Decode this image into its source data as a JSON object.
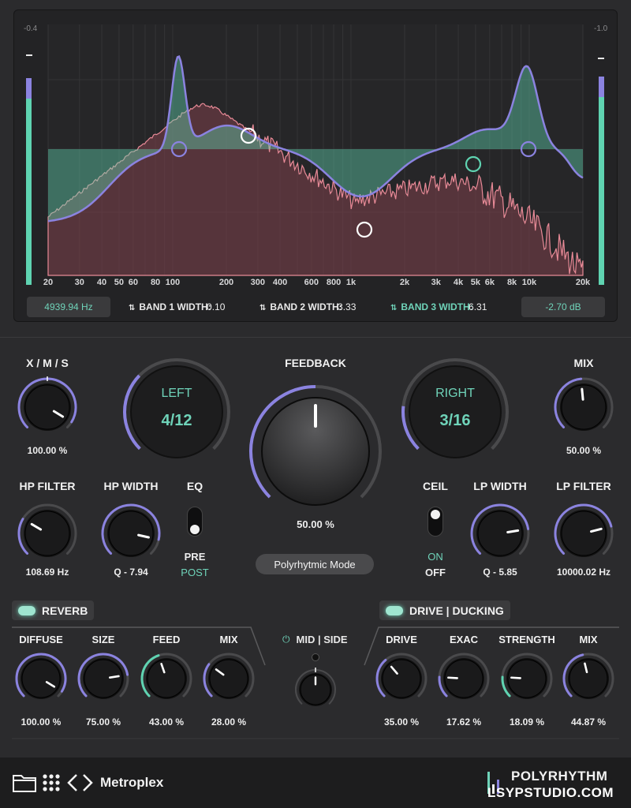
{
  "eq": {
    "corner_left": "-0.4",
    "corner_right": "-1.0",
    "freq_labels": [
      "20",
      "30",
      "40",
      "50",
      "60",
      "80",
      "100",
      "200",
      "300",
      "400",
      "600",
      "800",
      "1k",
      "2k",
      "3k",
      "4k",
      "5k",
      "6k",
      "8k",
      "10k",
      "20k"
    ],
    "readout_freq": "4939.94 Hz",
    "readout_db": "-2.70 dB",
    "bands": [
      {
        "label": "BAND 1 WIDTH:",
        "value": "0.10"
      },
      {
        "label": "BAND 2 WIDTH:",
        "value": "3.33"
      },
      {
        "label": "BAND 3 WIDTH:",
        "value": "6.31"
      }
    ],
    "colors": {
      "accent": "#8b83e0",
      "teal": "#5fd3b1",
      "spectrum": "#e88a97"
    }
  },
  "controls": {
    "xms": {
      "label": "X / M / S",
      "value": "100.00 %"
    },
    "left": {
      "label": "LEFT",
      "value": "4/12"
    },
    "feedback": {
      "label": "FEEDBACK",
      "value": "50.00 %"
    },
    "right": {
      "label": "RIGHT",
      "value": "3/16"
    },
    "mix": {
      "label": "MIX",
      "value": "50.00 %"
    },
    "hp_filter": {
      "label": "HP FILTER",
      "value": "108.69 Hz"
    },
    "hp_width": {
      "label": "HP WIDTH",
      "value": "Q - 7.94"
    },
    "eq": {
      "label": "EQ",
      "opt_a": "PRE",
      "opt_b": "POST"
    },
    "mode_button": "Polyrhytmic Mode",
    "ceil": {
      "label": "CEIL",
      "opt_a": "ON",
      "opt_b": "OFF"
    },
    "lp_width": {
      "label": "LP WIDTH",
      "value": "Q - 5.85"
    },
    "lp_filter": {
      "label": "LP FILTER",
      "value": "10000.02 Hz"
    }
  },
  "reverb": {
    "title": "REVERB",
    "knobs": [
      {
        "label": "DIFFUSE",
        "value": "100.00 %"
      },
      {
        "label": "SIZE",
        "value": "75.00 %"
      },
      {
        "label": "FEED",
        "value": "43.00 %"
      },
      {
        "label": "MIX",
        "value": "28.00 %"
      }
    ]
  },
  "midside": {
    "label": "MID | SIDE"
  },
  "drive": {
    "title": "DRIVE | DUCKING",
    "knobs": [
      {
        "label": "DRIVE",
        "value": "35.00 %"
      },
      {
        "label": "EXAC",
        "value": "17.62 %"
      },
      {
        "label": "STRENGTH",
        "value": "18.09 %"
      },
      {
        "label": "MIX",
        "value": "44.87 %"
      }
    ]
  },
  "footer": {
    "preset": "Metroplex",
    "brand": "POLYRHYTHM",
    "watermark": "LSYPSTUDIO.COM"
  }
}
